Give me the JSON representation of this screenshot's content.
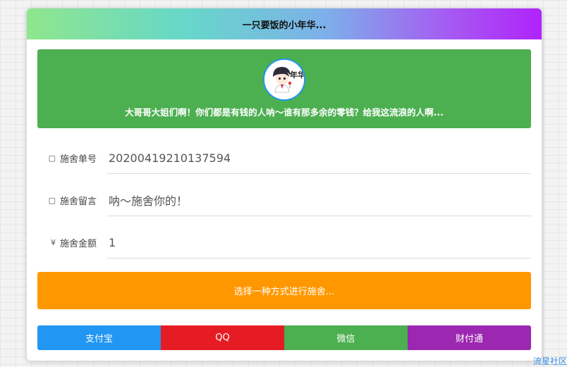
{
  "header": {
    "title": "一只要饭的小年华..."
  },
  "banner": {
    "avatar_icon": "anime-boy-avatar",
    "avatar_text": "年华",
    "message": "大哥哥大姐们啊！你们都是有钱的人呐～谁有那多余的零钱？给我这流浪的人啊..."
  },
  "form": {
    "order": {
      "icon": "▢",
      "label": "施舍单号",
      "value": "20200419210137594"
    },
    "note": {
      "icon": "▢",
      "label": "施舍留言",
      "value": "呐～施舍你的！"
    },
    "amount": {
      "icon": "¥",
      "label": "施舍金额",
      "value": "1"
    }
  },
  "action": {
    "label": "选择一种方式进行施舍..."
  },
  "payments": [
    {
      "label": "支付宝",
      "color": "#2196f3"
    },
    {
      "label": "QQ",
      "color": "#e51c23"
    },
    {
      "label": "微信",
      "color": "#4caf50"
    },
    {
      "label": "财付通",
      "color": "#9c27b0"
    }
  ],
  "watermark": {
    "text": "流星社区"
  }
}
